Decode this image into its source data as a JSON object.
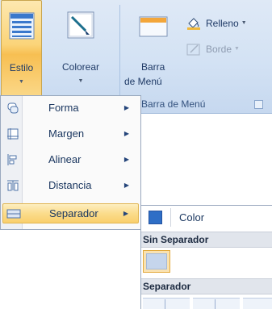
{
  "ribbon": {
    "estilo": {
      "label": "Estilo",
      "icon": "table-style-icon"
    },
    "colorear": {
      "label": "Colorear",
      "icon": "paint-brush-icon"
    },
    "barra": {
      "line1": "Barra",
      "line2": "de Menú",
      "icon": "menu-bar-icon"
    },
    "relleno": {
      "label": "Relleno",
      "icon": "fill-bucket-icon"
    },
    "borde": {
      "label": "Borde",
      "icon": "border-pen-icon",
      "disabled": true
    },
    "group_label": "Barra de Menú"
  },
  "menu": {
    "items": [
      {
        "label": "Forma",
        "icon": "shape-icon"
      },
      {
        "label": "Margen",
        "icon": "margin-icon"
      },
      {
        "label": "Alinear",
        "icon": "align-icon"
      },
      {
        "label": "Distancia",
        "icon": "distance-icon"
      },
      {
        "label": "Separador",
        "icon": "separator-icon",
        "active": true
      }
    ]
  },
  "submenu": {
    "color_label": "Color",
    "color_swatch": "#2e6ec6",
    "header_none": "Sin Separador",
    "header_sep": "Separador"
  },
  "colors": {
    "accent": "#fbd479",
    "ribbon_bg": "#d3e2f4",
    "text": "#1f3a66"
  }
}
